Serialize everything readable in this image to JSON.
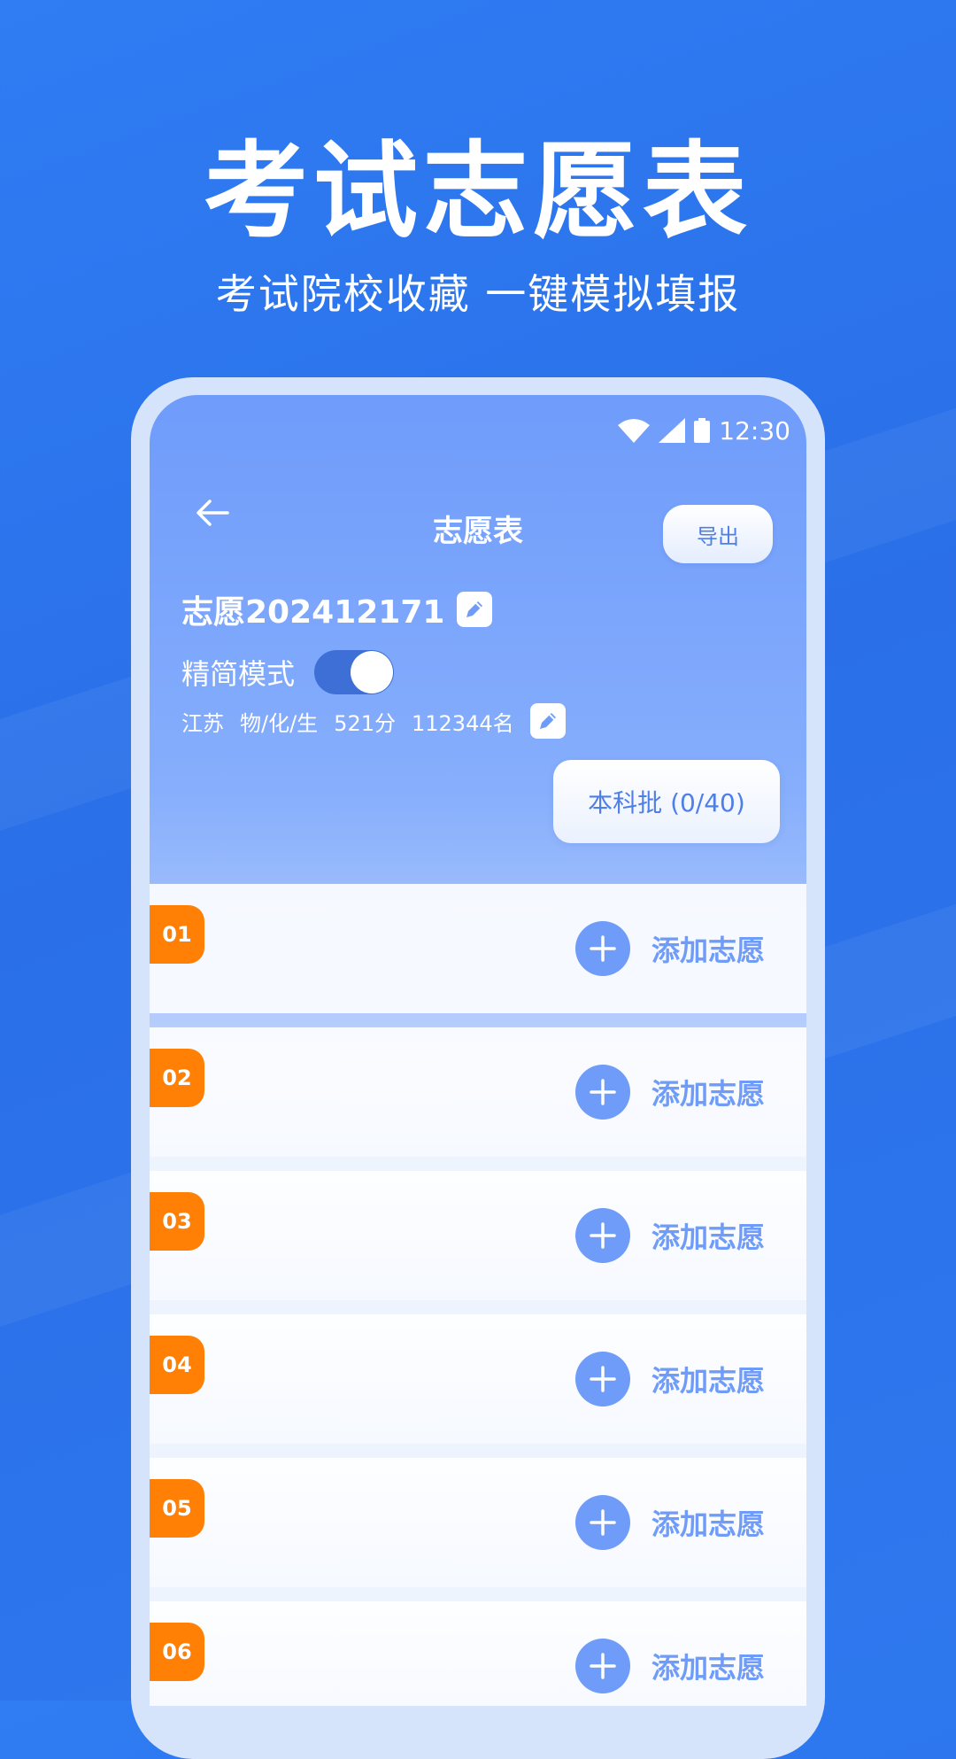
{
  "hero": {
    "title": "考试志愿表",
    "subtitle": "考试院校收藏 一键模拟填报"
  },
  "status_bar": {
    "time": "12:30",
    "icons": [
      "wifi-icon",
      "signal-icon",
      "battery-icon"
    ]
  },
  "header": {
    "back_icon": "back-arrow-icon",
    "title": "志愿表",
    "export_label": "导出"
  },
  "plan": {
    "name": "志愿202412171",
    "mode_label": "精简模式",
    "mode_enabled": true,
    "info": [
      "江苏",
      "物/化/生",
      "521分",
      "112344名"
    ]
  },
  "batch": {
    "label": "本科批 (0/40)"
  },
  "rows": [
    {
      "num": "01",
      "add_label": "添加志愿"
    },
    {
      "num": "02",
      "add_label": "添加志愿"
    },
    {
      "num": "03",
      "add_label": "添加志愿"
    },
    {
      "num": "04",
      "add_label": "添加志愿"
    },
    {
      "num": "05",
      "add_label": "添加志愿"
    },
    {
      "num": "06",
      "add_label": "添加志愿"
    }
  ],
  "colors": {
    "background": "#2f7cf3",
    "accent": "#6e9cf8",
    "badge": "#ff8005"
  }
}
